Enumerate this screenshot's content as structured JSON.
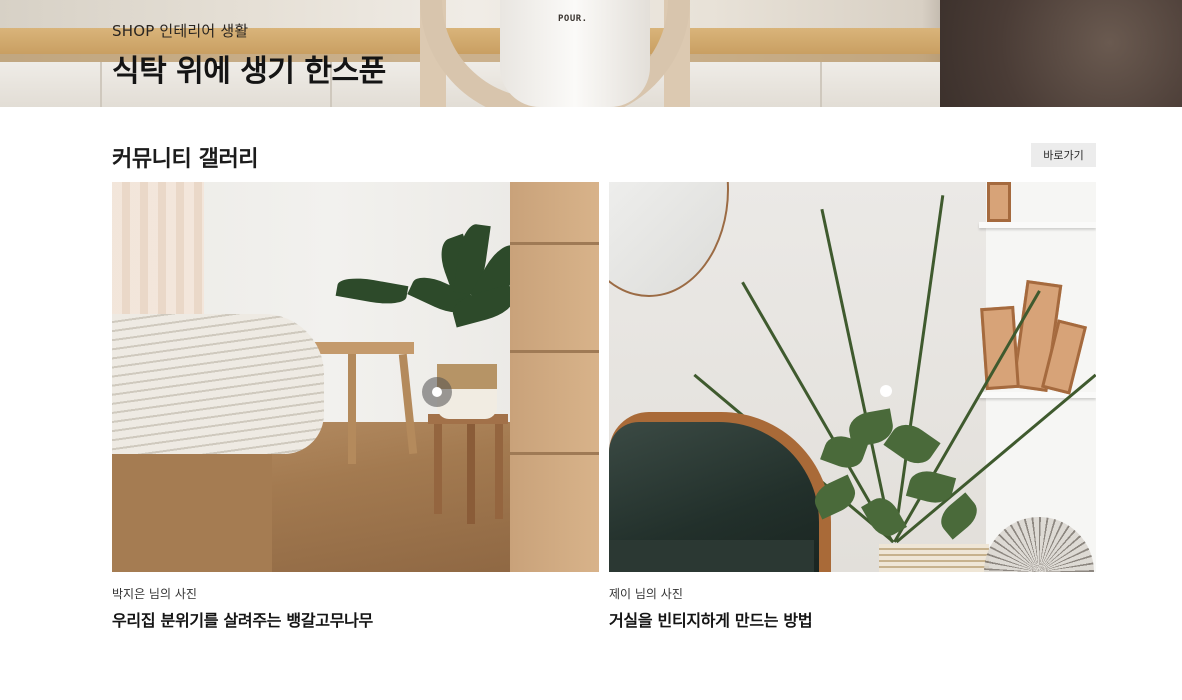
{
  "hero": {
    "eyebrow": "SHOP 인테리어 생활",
    "title": "식탁 위에 생기 한스푼",
    "image_text": "POUR."
  },
  "section": {
    "title": "커뮤니티 갤러리",
    "goto_label": "바로가기"
  },
  "gallery": [
    {
      "author": "박지은 님의 사진",
      "title": "우리집 분위기를 살려주는 뱅갈고무나무",
      "hotspots": 1
    },
    {
      "author": "제이 님의 사진",
      "title": "거실을 빈티지하게 만드는 방법",
      "hotspots": 1
    }
  ]
}
